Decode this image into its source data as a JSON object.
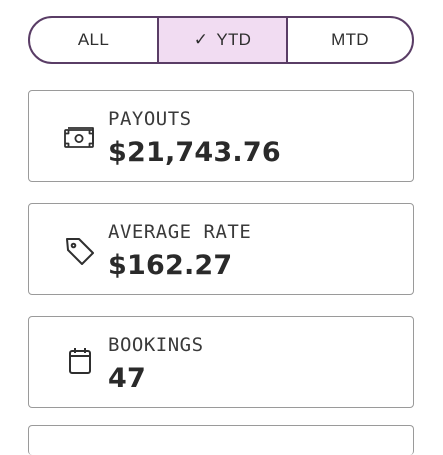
{
  "filter": {
    "options": [
      {
        "label": "ALL",
        "selected": false
      },
      {
        "label": "YTD",
        "selected": true
      },
      {
        "label": "MTD",
        "selected": false
      }
    ],
    "selected_check": "✓"
  },
  "stats": [
    {
      "label": "PAYOUTS",
      "value": "$21,743.76",
      "icon": "money-icon"
    },
    {
      "label": "AVERAGE RATE",
      "value": "$162.27",
      "icon": "tag-icon"
    },
    {
      "label": "BOOKINGS",
      "value": "47",
      "icon": "calendar-icon"
    }
  ],
  "colors": {
    "accent_border": "#5a3d66",
    "selected_background": "#f1dcf2",
    "card_border": "#9a9a9a"
  }
}
